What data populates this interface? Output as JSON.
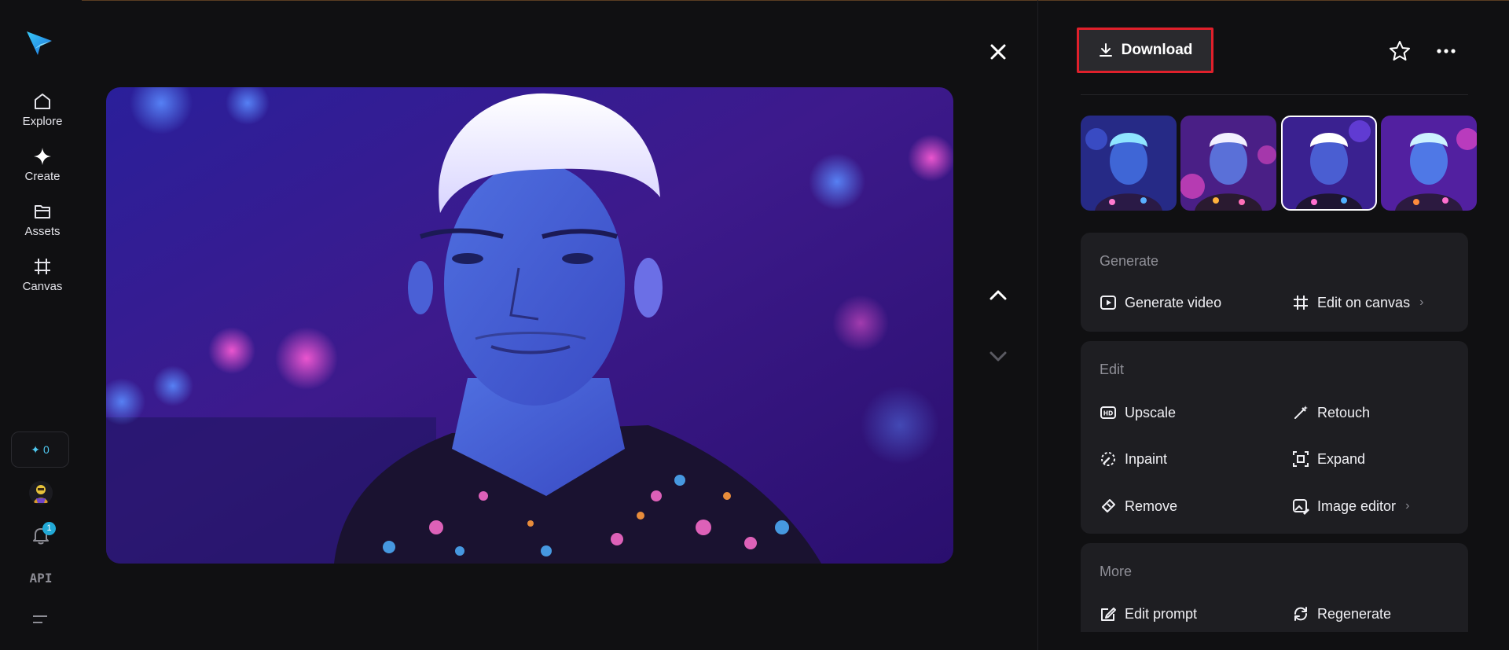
{
  "sidebar": {
    "nav": [
      {
        "label": "Explore",
        "icon": "home-icon"
      },
      {
        "label": "Create",
        "icon": "sparkle-icon"
      },
      {
        "label": "Assets",
        "icon": "folder-icon"
      },
      {
        "label": "Canvas",
        "icon": "canvas-icon"
      }
    ],
    "credits": "0",
    "notifications_count": "1",
    "api_label": "API"
  },
  "viewer": {
    "image_alt": "Portrait of a man with white hair in blue-purple neon light"
  },
  "panel": {
    "download_label": "Download",
    "thumbnails": [
      {
        "selected": false
      },
      {
        "selected": false
      },
      {
        "selected": true
      },
      {
        "selected": false
      }
    ],
    "sections": [
      {
        "title": "Generate",
        "actions": [
          {
            "label": "Generate video",
            "icon": "play-icon",
            "chevron": false
          },
          {
            "label": "Edit on canvas",
            "icon": "canvas-icon",
            "chevron": true
          }
        ]
      },
      {
        "title": "Edit",
        "actions": [
          {
            "label": "Upscale",
            "icon": "hd-icon",
            "chevron": false
          },
          {
            "label": "Retouch",
            "icon": "magic-wand-icon",
            "chevron": false
          },
          {
            "label": "Inpaint",
            "icon": "inpaint-icon",
            "chevron": false
          },
          {
            "label": "Expand",
            "icon": "expand-icon",
            "chevron": false
          },
          {
            "label": "Remove",
            "icon": "eraser-icon",
            "chevron": false
          },
          {
            "label": "Image editor",
            "icon": "image-edit-icon",
            "chevron": true
          }
        ]
      },
      {
        "title": "More",
        "actions": [
          {
            "label": "Edit prompt",
            "icon": "edit-prompt-icon",
            "chevron": false
          },
          {
            "label": "Regenerate",
            "icon": "regenerate-icon",
            "chevron": false
          }
        ]
      }
    ]
  },
  "colors": {
    "background": "#101012",
    "card": "#1e1e22",
    "accent_cyan": "#22a9d6",
    "highlight_red": "#e0202b"
  }
}
